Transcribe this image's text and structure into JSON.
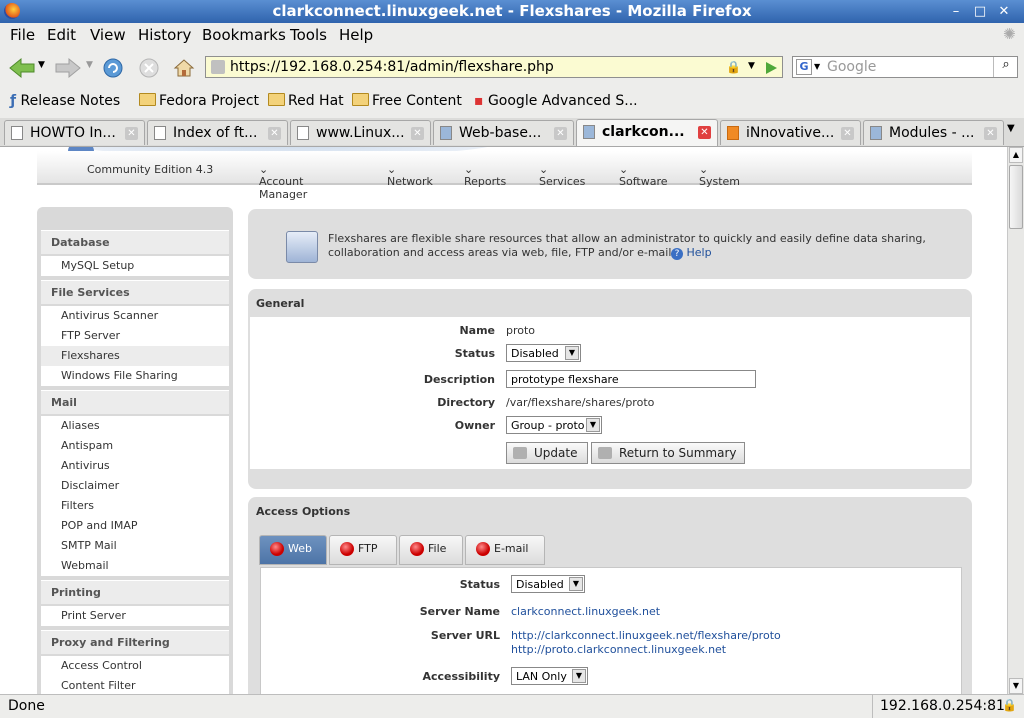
{
  "window": {
    "title": "clarkconnect.linuxgeek.net - Flexshares - Mozilla Firefox"
  },
  "menubar": [
    "File",
    "Edit",
    "View",
    "History",
    "Bookmarks",
    "Tools",
    "Help"
  ],
  "toolbar": {
    "url": "https://192.168.0.254:81/admin/flexshare.php",
    "search_placeholder": "Google"
  },
  "bookmarks": [
    "Release Notes",
    "Fedora Project",
    "Red Hat",
    "Free Content",
    "Google Advanced S..."
  ],
  "tabs": [
    "HOWTO In...",
    "Index of ft...",
    "www.Linux...",
    "Web-base...",
    "clarkcon...",
    "iNnovative...",
    "Modules - ..."
  ],
  "app": {
    "edition": "Community Edition 4.3",
    "nav": [
      "Account Manager",
      "Network",
      "Reports",
      "Services",
      "Software",
      "System"
    ]
  },
  "sidebar": {
    "sections": [
      {
        "title": "Database",
        "items": [
          "MySQL Setup"
        ]
      },
      {
        "title": "File Services",
        "items": [
          "Antivirus Scanner",
          "FTP Server",
          "Flexshares",
          "Windows File Sharing"
        ]
      },
      {
        "title": "Mail",
        "items": [
          "Aliases",
          "Antispam",
          "Antivirus",
          "Disclaimer",
          "Filters",
          "POP and IMAP",
          "SMTP Mail",
          "Webmail"
        ]
      },
      {
        "title": "Printing",
        "items": [
          "Print Server"
        ]
      },
      {
        "title": "Proxy and Filtering",
        "items": [
          "Access Control",
          "Content Filter"
        ]
      }
    ],
    "selected": "Flexshares"
  },
  "info": {
    "text_line1": "Flexshares are flexible share resources that allow an administrator to quickly and easily define data sharing,",
    "text_line2": "collaboration and access areas via web, file, FTP and/or e-mail.",
    "help": "Help"
  },
  "general": {
    "heading": "General",
    "labels": {
      "name": "Name",
      "status": "Status",
      "description": "Description",
      "directory": "Directory",
      "owner": "Owner"
    },
    "name": "proto",
    "status": "Disabled",
    "description": "prototype flexshare",
    "directory": "/var/flexshare/shares/proto",
    "owner": "Group - proto",
    "update_button": "Update",
    "return_button": "Return to Summary"
  },
  "access": {
    "heading": "Access Options",
    "tabs": [
      "Web",
      "FTP",
      "File",
      "E-mail"
    ],
    "active_tab": "Web",
    "labels": {
      "status": "Status",
      "server_name": "Server Name",
      "server_url": "Server URL",
      "accessibility": "Accessibility"
    },
    "status": "Disabled",
    "server_name": "clarkconnect.linuxgeek.net",
    "server_url_1": "http://clarkconnect.linuxgeek.net/flexshare/proto",
    "server_url_2": "http://proto.clarkconnect.linuxgeek.net",
    "accessibility": "LAN Only"
  },
  "status_bar": {
    "left": "Done",
    "right": "192.168.0.254:81"
  }
}
